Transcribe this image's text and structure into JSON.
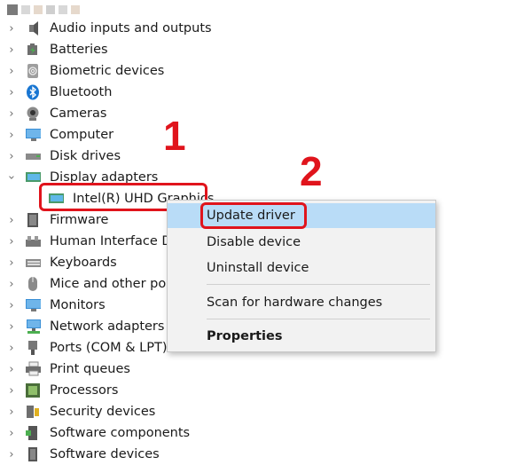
{
  "tree": {
    "categories": [
      {
        "label": "Audio inputs and outputs",
        "icon": "speaker-icon",
        "expanded": false
      },
      {
        "label": "Batteries",
        "icon": "battery-icon",
        "expanded": false
      },
      {
        "label": "Biometric devices",
        "icon": "fingerprint-icon",
        "expanded": false
      },
      {
        "label": "Bluetooth",
        "icon": "bluetooth-icon",
        "expanded": false
      },
      {
        "label": "Cameras",
        "icon": "camera-icon",
        "expanded": false
      },
      {
        "label": "Computer",
        "icon": "monitor-icon",
        "expanded": false
      },
      {
        "label": "Disk drives",
        "icon": "disk-drive-icon",
        "expanded": false
      },
      {
        "label": "Display adapters",
        "icon": "display-adapter-icon",
        "expanded": true
      },
      {
        "label": "Intel(R) UHD Graphics",
        "icon": "display-adapter-icon",
        "child": true
      },
      {
        "label": "Firmware",
        "icon": "chip-icon",
        "expanded": false
      },
      {
        "label": "Human Interface De",
        "icon": "hid-icon",
        "expanded": false
      },
      {
        "label": "Keyboards",
        "icon": "keyboard-icon",
        "expanded": false
      },
      {
        "label": "Mice and other poi",
        "icon": "mouse-icon",
        "expanded": false
      },
      {
        "label": "Monitors",
        "icon": "monitor-icon",
        "expanded": false
      },
      {
        "label": "Network adapters",
        "icon": "network-icon",
        "expanded": false
      },
      {
        "label": "Ports (COM & LPT)",
        "icon": "port-icon",
        "expanded": false
      },
      {
        "label": "Print queues",
        "icon": "printer-icon",
        "expanded": false
      },
      {
        "label": "Processors",
        "icon": "processor-icon",
        "expanded": false
      },
      {
        "label": "Security devices",
        "icon": "security-icon",
        "expanded": false
      },
      {
        "label": "Software components",
        "icon": "software-component-icon",
        "expanded": false
      },
      {
        "label": "Software devices",
        "icon": "software-device-icon",
        "expanded": false
      }
    ]
  },
  "context_menu": {
    "items": [
      {
        "label": "Update driver",
        "highlighted": true
      },
      {
        "label": "Disable device"
      },
      {
        "label": "Uninstall device"
      },
      {
        "label": "Scan for hardware changes"
      },
      {
        "label": "Properties",
        "bold": true
      }
    ]
  },
  "annotations": {
    "step1": "1",
    "step2": "2",
    "color": "#e0141c"
  }
}
